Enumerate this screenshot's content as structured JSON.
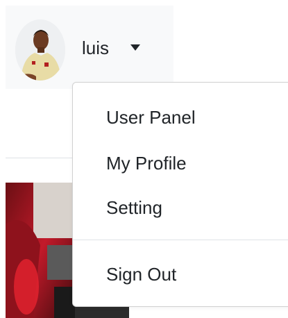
{
  "user": {
    "name": "luis",
    "avatar_icon": "user-avatar"
  },
  "menu": {
    "items": [
      {
        "label": "User Panel"
      },
      {
        "label": "My Profile"
      },
      {
        "label": "Setting"
      },
      {
        "label": "Sign Out"
      }
    ]
  },
  "colors": {
    "toggle_bg": "#f8f9fa",
    "text": "#212529",
    "border": "#dee2e6"
  }
}
